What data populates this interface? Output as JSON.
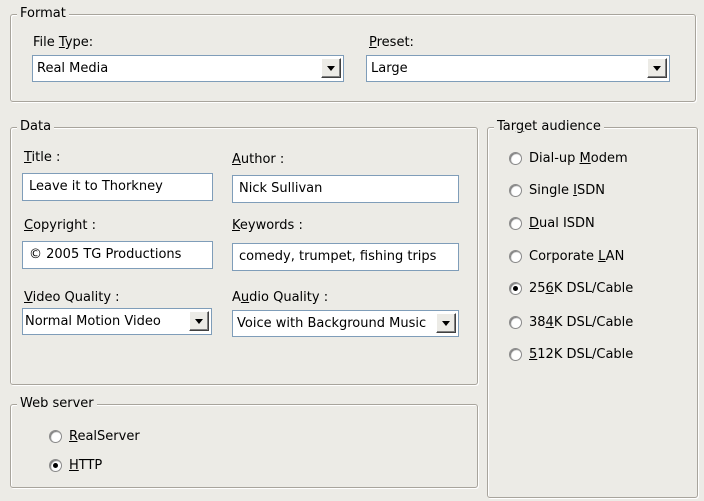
{
  "format": {
    "legend": "Format",
    "file_type": {
      "pre": "File ",
      "key": "T",
      "post": "ype:",
      "value": "Real Media"
    },
    "preset": {
      "pre": "",
      "key": "P",
      "post": "reset:",
      "value": "Large"
    }
  },
  "data": {
    "legend": "Data",
    "title": {
      "key": "T",
      "post": "itle :",
      "value": "Leave it to Thorkney"
    },
    "author": {
      "key": "A",
      "post": "uthor :",
      "value": "Nick Sullivan"
    },
    "copyright": {
      "key": "C",
      "post": "opyright :",
      "value": "© 2005 TG Productions"
    },
    "keywords": {
      "key": "K",
      "post": "eywords :",
      "value": "comedy, trumpet, fishing trips"
    },
    "video_quality": {
      "key": "V",
      "post": "ideo Quality :",
      "value": "Normal Motion Video"
    },
    "audio_quality": {
      "pre": "A",
      "key": "u",
      "post": "dio Quality :",
      "value": "Voice with Background Music"
    }
  },
  "web_server": {
    "legend": "Web server",
    "options": [
      {
        "pre": "",
        "key": "R",
        "post": "ealServer",
        "selected": false
      },
      {
        "pre": "",
        "key": "H",
        "post": "TTP",
        "selected": true
      }
    ]
  },
  "target_audience": {
    "legend": {
      "pre": "Tar",
      "key": "g",
      "post": "et audience"
    },
    "options": [
      {
        "pre": "Dial-up ",
        "key": "M",
        "post": "odem",
        "selected": false
      },
      {
        "pre": "Single ",
        "key": "I",
        "post": "SDN",
        "selected": false
      },
      {
        "pre": "",
        "key": "D",
        "post": "ual ISDN",
        "selected": false
      },
      {
        "pre": "Corporate ",
        "key": "L",
        "post": "AN",
        "selected": false
      },
      {
        "pre": "25",
        "key": "6",
        "post": "K DSL/Cable",
        "selected": true
      },
      {
        "pre": "38",
        "key": "4",
        "post": "K DSL/Cable",
        "selected": false
      },
      {
        "pre": "",
        "key": "5",
        "post": "12K DSL/Cable",
        "selected": false
      }
    ]
  }
}
